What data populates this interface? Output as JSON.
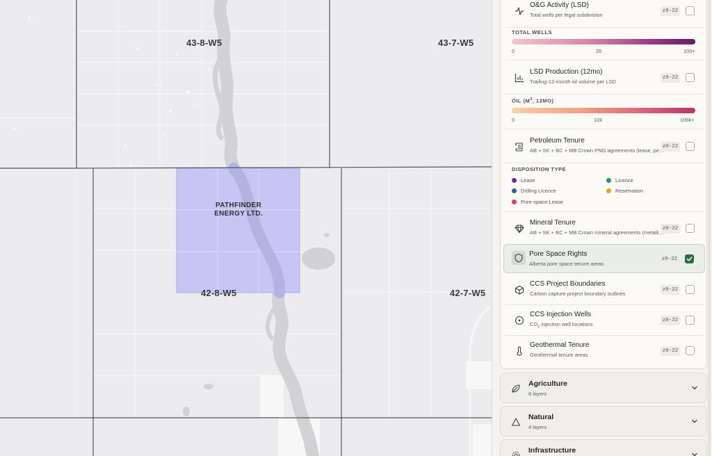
{
  "map": {
    "township_labels": [
      "43-8-W5",
      "43-7-W5",
      "42-8-W5",
      "42-7-W5"
    ],
    "parcel_label_line1": "PATHFINDER",
    "parcel_label_line2": "ENERGY LTD.",
    "parcel_color": "#c5c5f5"
  },
  "sidebar": {
    "layers": [
      {
        "title": "O&G Activity (LSD)",
        "subtitle": "Total wells per legal subdivision",
        "zoom": "z9-22",
        "icon": "activity-icon",
        "checked": false
      },
      {
        "title": "LSD Production (12mo)",
        "subtitle": "Trailing-12-month oil volume per LSD",
        "zoom": "z9-22",
        "icon": "bar-chart-icon",
        "checked": false
      },
      {
        "title": "Petroleum Tenure",
        "subtitle": "AB + SK + BC + MB Crown PNG agreements (lease, permit, licence)",
        "zoom": "z0-22",
        "icon": "scroll-icon",
        "checked": false
      },
      {
        "title": "Mineral Tenure",
        "subtitle": "AB + SK + BC + MB Crown mineral agreements (metallic and industrial)",
        "zoom": "z0-22",
        "icon": "gem-icon",
        "checked": false
      },
      {
        "title": "Pore Space Rights",
        "subtitle": "Alberta pore space tenure areas",
        "zoom": "z0-22",
        "icon": "shield-icon",
        "checked": true
      },
      {
        "title": "CCS Project Boundaries",
        "subtitle": "Carbon capture project boundary outlines",
        "zoom": "z0-22",
        "icon": "cube-icon",
        "checked": false
      },
      {
        "title": "CCS Injection Wells",
        "subtitle_pre": "CO",
        "subtitle_sub": "2",
        "subtitle_post": " injection well locations",
        "zoom": "z0-22",
        "icon": "target-icon",
        "checked": false
      },
      {
        "title": "Geothermal Tenure",
        "subtitle": "Geothermal tenure areas",
        "zoom": "z0-22",
        "icon": "thermometer-icon",
        "checked": false
      }
    ],
    "total_wells_legend": {
      "heading": "TOTAL WELLS",
      "ticks": [
        "0",
        "20",
        "100+"
      ]
    },
    "oil_legend": {
      "heading_pre": "OIL (M",
      "heading_sup": "3",
      "heading_post": ", 12MO)",
      "ticks": [
        "0",
        "10k",
        "100k+"
      ]
    },
    "disposition_legend": {
      "heading": "DISPOSITION TYPE",
      "items": [
        {
          "label": "Lease",
          "color": "#6b2d8a"
        },
        {
          "label": "Licence",
          "color": "#1f9a6e"
        },
        {
          "label": "Drilling Licence",
          "color": "#2f5fa8"
        },
        {
          "label": "Reservation",
          "color": "#e2a81a"
        },
        {
          "label": "Pore-space Lease",
          "color": "#d0426e"
        }
      ]
    },
    "groups": [
      {
        "title": "Agriculture",
        "count": "8 layers",
        "icon": "leaf-icon"
      },
      {
        "title": "Natural",
        "count": "4 layers",
        "icon": "mountain-icon"
      },
      {
        "title": "Infrastructure",
        "count": "",
        "icon": "gear-icon"
      }
    ]
  }
}
